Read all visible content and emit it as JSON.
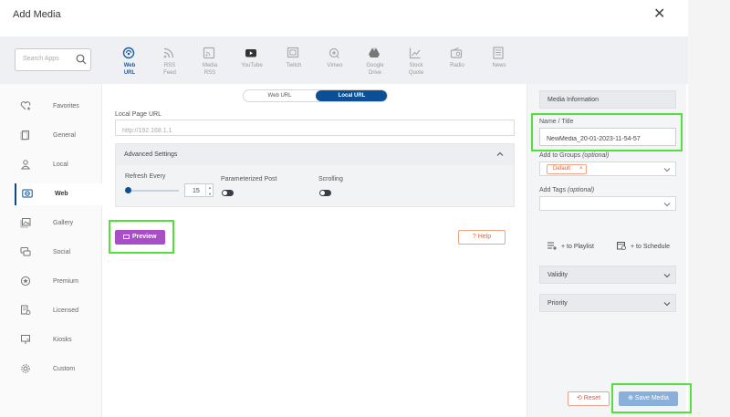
{
  "window": {
    "title": "Add Media",
    "close_symbol": "✕"
  },
  "search": {
    "placeholder": "Search Apps"
  },
  "sidebar": {
    "items": [
      {
        "label": "Favorites",
        "icon": "heart-star-icon"
      },
      {
        "label": "General",
        "icon": "document-icon"
      },
      {
        "label": "Local",
        "icon": "person-icon"
      },
      {
        "label": "Web",
        "icon": "web-icon",
        "active": true
      },
      {
        "label": "Gallery",
        "icon": "gallery-icon"
      },
      {
        "label": "Social",
        "icon": "chat-icon"
      },
      {
        "label": "Premium",
        "icon": "premium-icon"
      },
      {
        "label": "Licensed",
        "icon": "licensed-icon"
      },
      {
        "label": "Kiosks",
        "icon": "kiosk-icon"
      },
      {
        "label": "Custom",
        "icon": "gear-icon"
      }
    ]
  },
  "tabs": [
    {
      "line1": "Web",
      "line2": "URL",
      "icon": "web-url-icon",
      "active": true
    },
    {
      "line1": "RSS",
      "line2": "Feed",
      "icon": "rss-icon"
    },
    {
      "line1": "Media",
      "line2": "RSS",
      "icon": "media-rss-icon"
    },
    {
      "line1": "YouTube",
      "line2": "",
      "icon": "youtube-icon"
    },
    {
      "line1": "Twitch",
      "line2": "",
      "icon": "twitch-icon"
    },
    {
      "line1": "Vimeo",
      "line2": "",
      "icon": "vimeo-icon"
    },
    {
      "line1": "Google",
      "line2": "Drive",
      "icon": "google-drive-icon"
    },
    {
      "line1": "Stock",
      "line2": "Quote",
      "icon": "stock-quote-icon"
    },
    {
      "line1": "Radio",
      "line2": "",
      "icon": "radio-icon"
    },
    {
      "line1": "News",
      "line2": "",
      "icon": "news-icon"
    }
  ],
  "url_toggle": {
    "web_url": "Web URL",
    "local_url": "Local URL",
    "selected": "Local URL"
  },
  "local_page": {
    "label": "Local Page URL",
    "placeholder": "http://192.168.1.1"
  },
  "advanced": {
    "title": "Advanced Settings",
    "refresh_label": "Refresh Every",
    "refresh_value": "15",
    "refresh_slider_level": 0.05,
    "parameterized_label": "Parameterized Post",
    "parameterized_on": false,
    "scrolling_label": "Scrolling",
    "scrolling_on": false
  },
  "buttons": {
    "preview": "Preview",
    "help": "Help",
    "help_symbol": "?",
    "reset": "Reset",
    "reset_symbol": "⟲",
    "save": "Save Media",
    "save_symbol": "⊕"
  },
  "media_info": {
    "title": "Media Information",
    "name_label": "Name / Title",
    "name_value": "NewMedia_20-01-2023-11-54-57",
    "groups_label": "Add to Groups",
    "groups_optional": "(optional)",
    "group_chip": "Default",
    "chip_remove": "×",
    "tags_label": "Add Tags",
    "tags_optional": "(optional)",
    "to_playlist": "+ to Playlist",
    "to_schedule": "+ to Schedule",
    "validity": "Validity",
    "priority": "Priority"
  },
  "colors": {
    "accent": "#0d4f95",
    "preview": "#a84fc8",
    "highlight": "#53e03c",
    "save": "#8ab0d9",
    "reset": "#e05a4a"
  }
}
